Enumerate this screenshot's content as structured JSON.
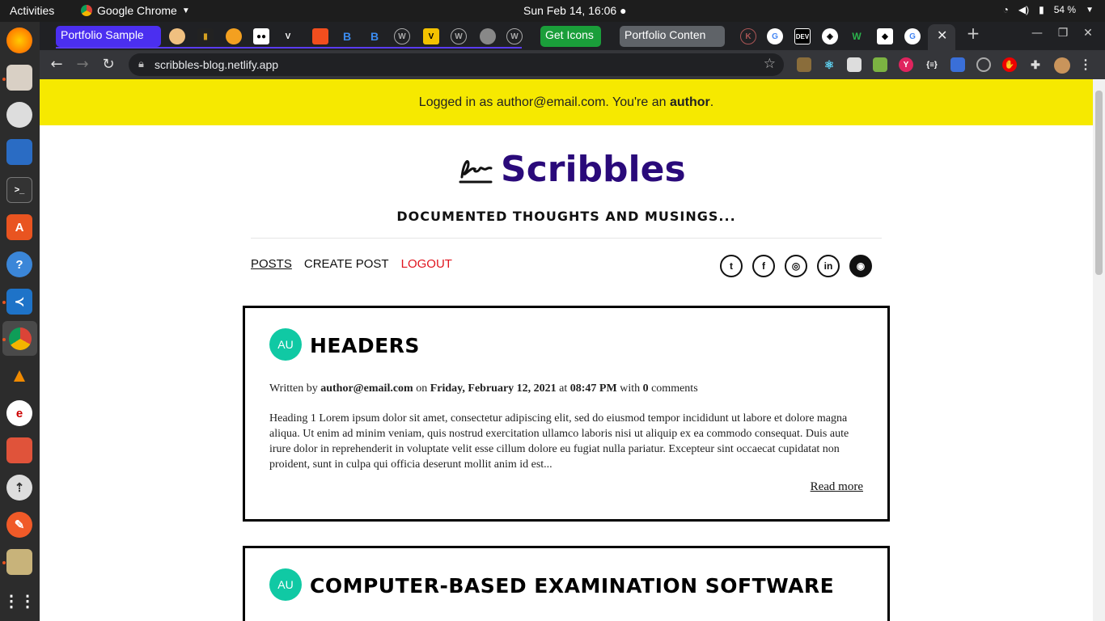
{
  "system": {
    "activities": "Activities",
    "app_name": "Google Chrome",
    "clock": "Sun Feb 14, 16:06",
    "battery": "54 %"
  },
  "browser": {
    "tabs": {
      "portfolio_sample": "Portfolio Sample",
      "get_icons": "Get Icons",
      "portfolio_content": "Portfolio Conten"
    },
    "url": "scribbles-blog.netlify.app"
  },
  "page": {
    "banner": {
      "prefix": "Logged in as author@email.com. You're an ",
      "role": "author",
      "suffix": "."
    },
    "site_title": "Scribbles",
    "tagline": "DOCUMENTED THOUGHTS AND MUSINGS...",
    "nav": {
      "posts": "POSTS",
      "create_post": "CREATE POST",
      "logout": "LOGOUT"
    },
    "social": {
      "twitter": "t",
      "facebook": "f",
      "instagram": "◎",
      "linkedin": "in",
      "github": "◉"
    },
    "posts": [
      {
        "avatar": "AU",
        "title": "Headers",
        "written_by": "Written by ",
        "author": "author@email.com",
        "on": " on ",
        "date": "Friday, February 12, 2021",
        "at": " at ",
        "time": "08:47 PM",
        "with": " with ",
        "comments_count": "0",
        "comments_label": " comments",
        "excerpt": "Heading 1 Lorem ipsum dolor sit amet, consectetur adipiscing elit, sed do eiusmod tempor incididunt ut labore et dolore magna aliqua. Ut enim ad minim veniam, quis nostrud exercitation ullamco laboris nisi ut aliquip ex ea commodo consequat. Duis aute irure dolor in reprehenderit in voluptate velit esse cillum dolore eu fugiat nulla pariatur. Excepteur sint occaecat cupidatat non proident, sunt in culpa qui officia deserunt mollit anim id est...",
        "read_more": "Read more"
      },
      {
        "avatar": "AU",
        "title": "Computer-Based Examination Software"
      }
    ]
  }
}
